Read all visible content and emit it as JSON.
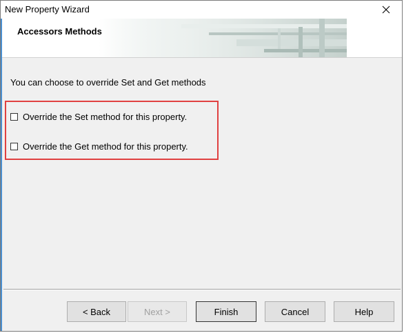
{
  "window": {
    "title": "New Property Wizard",
    "close_icon": "close-icon"
  },
  "header": {
    "title": "Accessors Methods"
  },
  "main": {
    "intro": "You can choose to override Set and Get methods",
    "options": [
      {
        "label": "Override the Set method for this property.",
        "checked": false
      },
      {
        "label": "Override the Get method for this property.",
        "checked": false
      }
    ],
    "highlight_color": "#e04040"
  },
  "buttons": {
    "back": "< Back",
    "next": "Next >",
    "finish": "Finish",
    "cancel": "Cancel",
    "help": "Help"
  }
}
